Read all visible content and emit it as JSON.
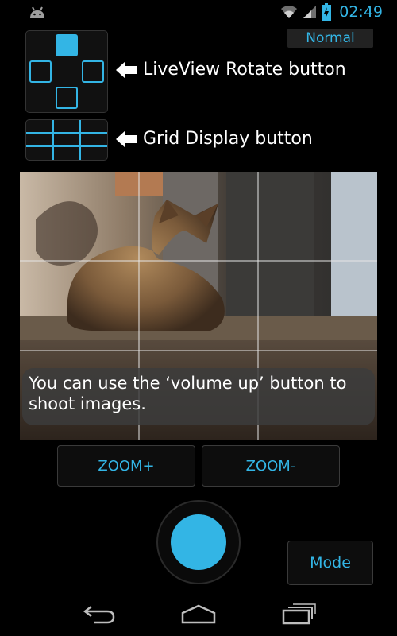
{
  "status_bar": {
    "time": "02:49",
    "icons": [
      "android-debug-icon",
      "wifi-icon",
      "signal-icon",
      "battery-charging-icon"
    ]
  },
  "mode_indicator": "Normal",
  "callouts": {
    "rotate_label": "LiveView Rotate button",
    "grid_label": "Grid Display button"
  },
  "preview": {
    "tip_text": "You can use the ‘volume up’ button to shoot images."
  },
  "controls": {
    "zoom_in_label": "ZOOM+",
    "zoom_out_label": "ZOOM-",
    "mode_label": "Mode"
  },
  "colors": {
    "accent": "#33b5e5",
    "background": "#000000"
  },
  "nav_icons": [
    "back-icon",
    "home-icon",
    "recent-apps-icon"
  ]
}
